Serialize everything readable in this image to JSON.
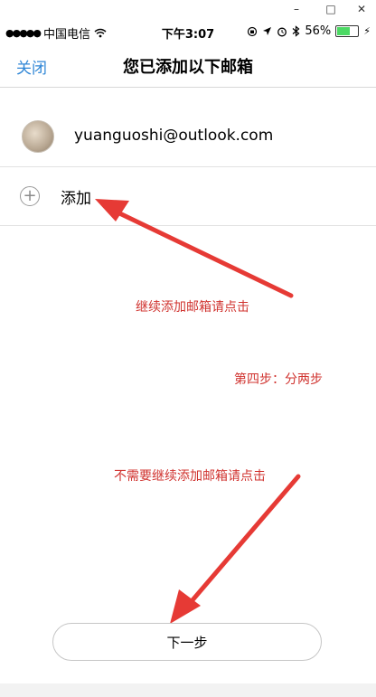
{
  "window": {
    "minimize": "–",
    "maximize": "□",
    "close": "✕"
  },
  "status_bar": {
    "signal": "●●●●●",
    "carrier": "中国电信",
    "wifi_icon": "wifi-icon",
    "time": "下午3:07",
    "battery": "56%",
    "battery_level": 0.56
  },
  "nav": {
    "close_label": "关闭",
    "title": "您已添加以下邮箱"
  },
  "account": {
    "email": "yuanguoshi@outlook.com"
  },
  "add_row": {
    "plus": "+",
    "label": "添加"
  },
  "annotations": {
    "continue_add": "继续添加邮箱请点击",
    "step_four": "第四步：分两步",
    "no_more": "不需要继续添加邮箱请点击",
    "color": "#d0332f"
  },
  "next_button": {
    "label": "下一步"
  }
}
